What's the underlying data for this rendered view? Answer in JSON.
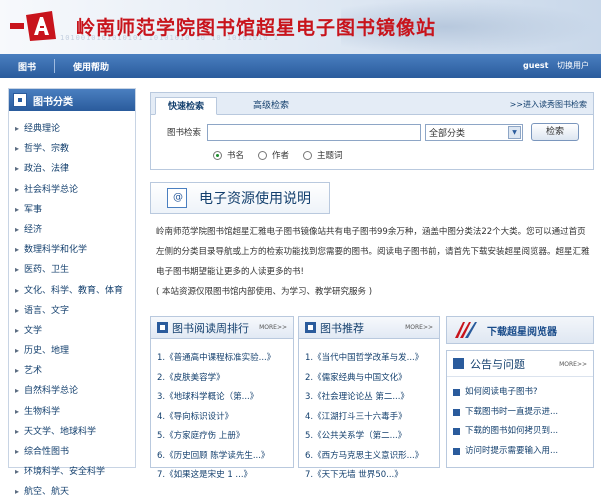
{
  "banner": {
    "title": "岭南师范学院图书馆超星电子图书镜像站",
    "binary_text": "1010010101010101   10101010   10 10 10101010 1"
  },
  "nav": {
    "books": "图书",
    "help": "使用帮助",
    "user": "guest",
    "switch_user": "切换用户"
  },
  "sidebar": {
    "title": "图书分类",
    "items": [
      {
        "label": "经典理论"
      },
      {
        "label": "哲学、宗教"
      },
      {
        "label": "政治、法律"
      },
      {
        "label": "社会科学总论"
      },
      {
        "label": "军事"
      },
      {
        "label": "经济"
      },
      {
        "label": "数理科学和化学"
      },
      {
        "label": "医药、卫生"
      },
      {
        "label": "文化、科学、教育、体育"
      },
      {
        "label": "语言、文字"
      },
      {
        "label": "文学"
      },
      {
        "label": "历史、地理"
      },
      {
        "label": "艺术"
      },
      {
        "label": "自然科学总论"
      },
      {
        "label": "生物科学"
      },
      {
        "label": "天文学、地球科学"
      },
      {
        "label": "综合性图书"
      },
      {
        "label": "环境科学、安全科学"
      },
      {
        "label": "航空、航天"
      }
    ]
  },
  "search": {
    "tab_quick": "快速检索",
    "tab_advanced": "高级检索",
    "enter_link": ">>进入读秀图书检索",
    "label": "图书检索",
    "value": "",
    "category_selected": "全部分类",
    "button": "检索",
    "radios": [
      {
        "label": "书名",
        "checked": true
      },
      {
        "label": "作者",
        "checked": false
      },
      {
        "label": "主题词",
        "checked": false
      }
    ]
  },
  "resources": {
    "title": "电子资源使用说明",
    "para1": "岭南师范学院图书馆超星汇雅电子图书镜像站共有电子图书99余万种，涵盖中图分类法22个大类。您可以通过首页左侧的分类目录导航或上方的检索功能找到您需要的图书。阅读电子图书前，请首先下载安装超星阅览器。超星汇雅电子图书期望能让更多的人读更多的书!",
    "para2": "( 本站资源仅限图书馆内部使用、为学习、教学研究服务 )"
  },
  "weekly": {
    "title": "图书阅读周排行",
    "more": "MORE>>",
    "items": [
      {
        "label": "1.《普通高中课程标准实验...》"
      },
      {
        "label": "2.《皮肤美容学》"
      },
      {
        "label": "3.《地球科学概论（第...》"
      },
      {
        "label": "4.《导向标识设计》"
      },
      {
        "label": "5.《方家庭疗伤 上册》"
      },
      {
        "label": "6.《历史回顾 陈学读先生...》"
      },
      {
        "label": "7.《如果这是宋史 1 ...》"
      }
    ]
  },
  "recommend": {
    "title": "图书推荐",
    "more": "MORE>>",
    "items": [
      {
        "label": "1.《当代中国哲学改革与发...》"
      },
      {
        "label": "2.《儒家经典与中国文化》"
      },
      {
        "label": "3.《社会理论论丛 第二...》"
      },
      {
        "label": "4.《江湖打斗三十六毒手》"
      },
      {
        "label": "5.《公共关系学（第二...》"
      },
      {
        "label": "6.《西方马克思主义意识形...》"
      },
      {
        "label": "7.《天下无墙 世界50...》"
      }
    ]
  },
  "download": {
    "label": "下载超星阅览器"
  },
  "notice": {
    "title": "公告与问题",
    "more": "MORE>>",
    "items": [
      {
        "label": "如何阅读电子图书?"
      },
      {
        "label": "下载图书时一直提示进..."
      },
      {
        "label": "下载的图书如何拷贝到..."
      },
      {
        "label": "访问时提示需要输入用..."
      }
    ]
  },
  "colors": {
    "brand_red": "#c8141c",
    "nav_blue": "#2a5b9c",
    "link_blue": "#14406e"
  },
  "icons": [
    "logo-icon",
    "category-icon",
    "info-icon",
    "list-icon",
    "reader-flag-icon"
  ]
}
